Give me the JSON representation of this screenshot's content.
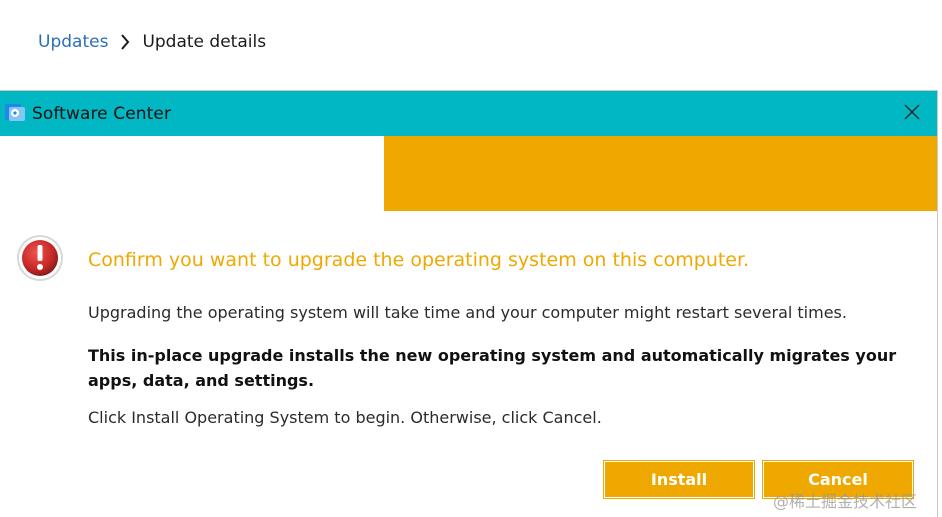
{
  "breadcrumb": {
    "parent": "Updates",
    "current": "Update details"
  },
  "dialog": {
    "title": "Software Center",
    "headline": "Confirm you want to upgrade the operating system on this computer.",
    "paragraph1": "Upgrading the operating system will take time and your computer might restart several times.",
    "paragraph2": "This in-place upgrade installs the new operating system and automatically migrates your apps, data, and settings.",
    "paragraph3": "Click Install Operating System to begin. Otherwise, click Cancel.",
    "install_label": "Install",
    "cancel_label": "Cancel"
  },
  "watermark": "@稀土掘金技术社区",
  "colors": {
    "titlebar": "#00b7c3",
    "accent": "#efa800",
    "link": "#2b6fb7",
    "warning": "#c62828"
  },
  "icons": {
    "app": "software-center-icon",
    "close": "close-icon",
    "warning": "error-icon",
    "separator": "chevron-right-icon"
  }
}
